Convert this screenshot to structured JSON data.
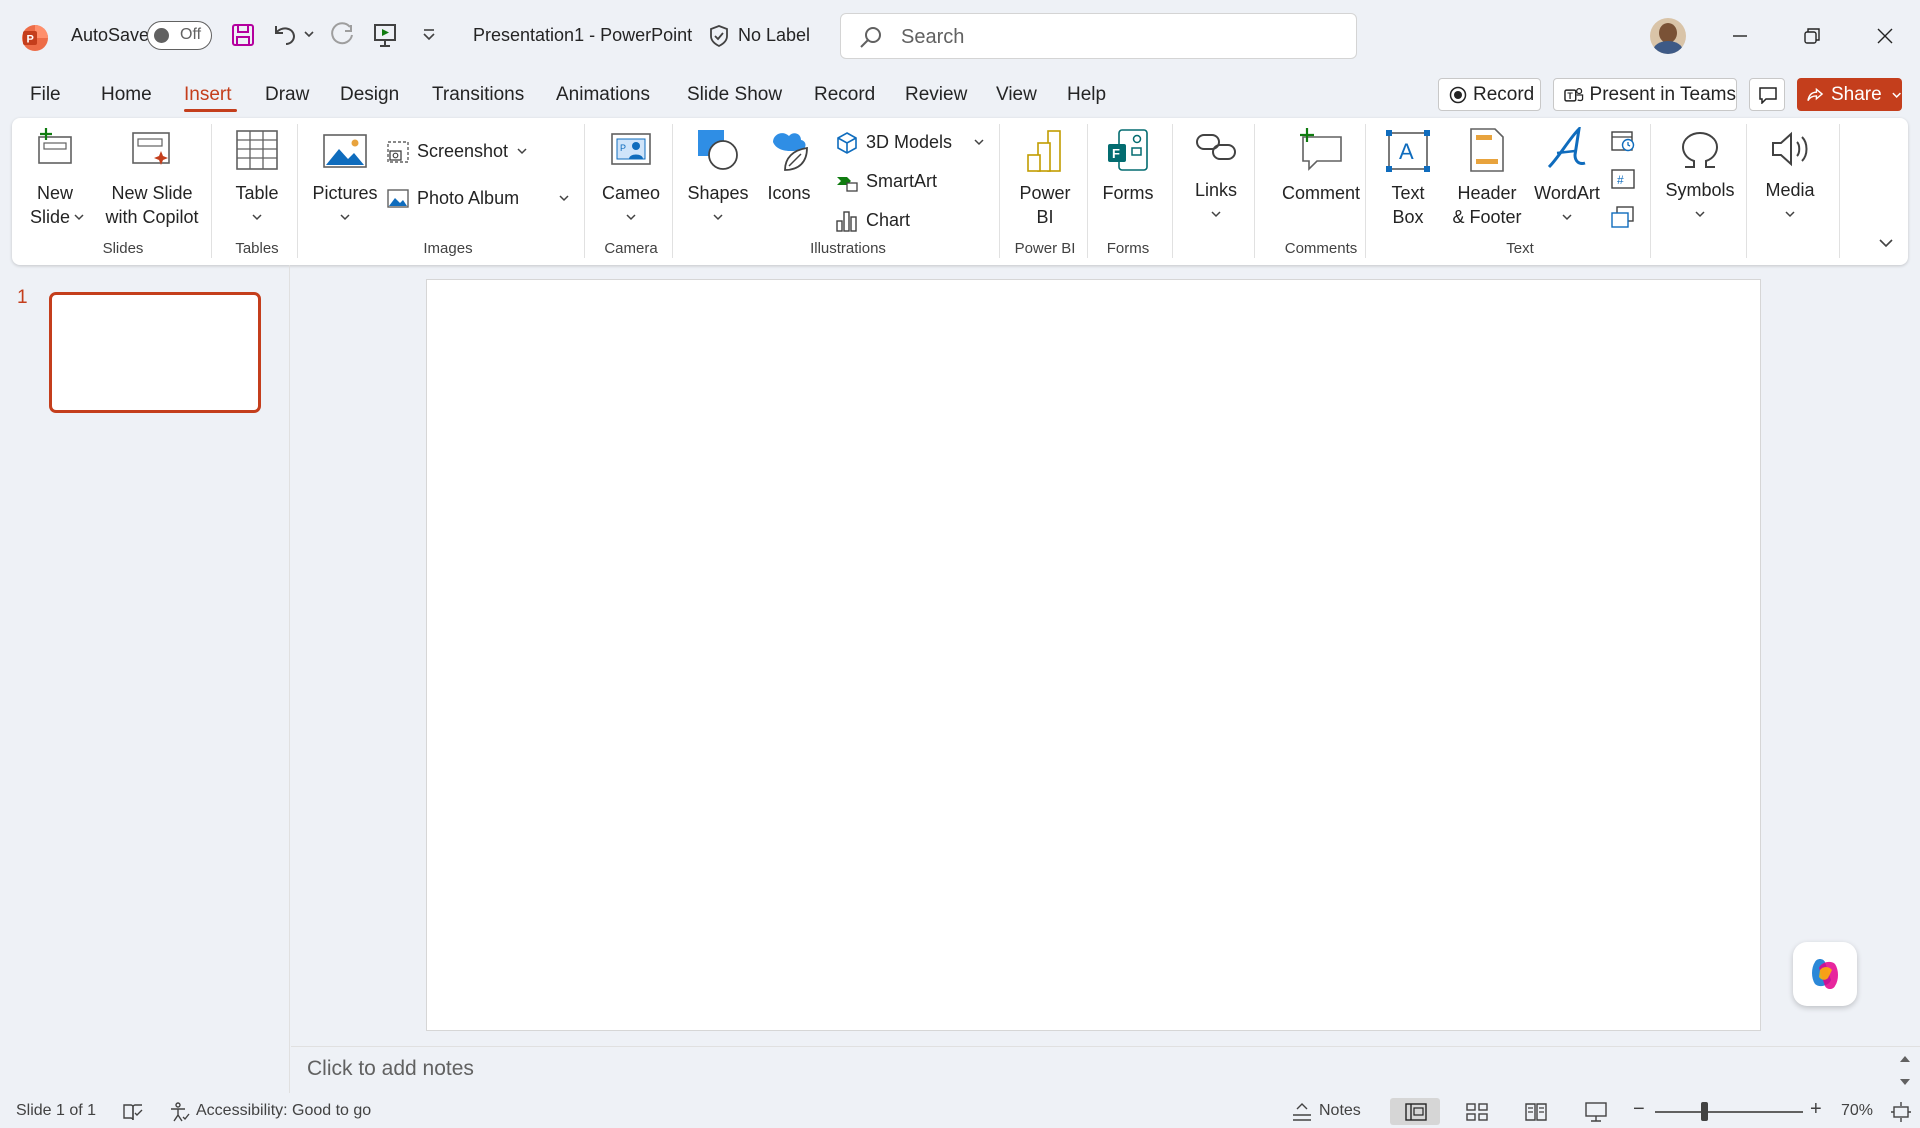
{
  "titlebar": {
    "autosave_label": "AutoSave",
    "autosave_state": "Off",
    "doc_title": "Presentation1  -  PowerPoint",
    "sensitivity_label": "No Label",
    "search_placeholder": "Search"
  },
  "tabs": [
    {
      "label": "File"
    },
    {
      "label": "Home"
    },
    {
      "label": "Insert"
    },
    {
      "label": "Draw"
    },
    {
      "label": "Design"
    },
    {
      "label": "Transitions"
    },
    {
      "label": "Animations"
    },
    {
      "label": "Slide Show"
    },
    {
      "label": "Record"
    },
    {
      "label": "Review"
    },
    {
      "label": "View"
    },
    {
      "label": "Help"
    }
  ],
  "active_tab": "Insert",
  "header_buttons": {
    "record": "Record",
    "present_in_teams": "Present in Teams",
    "share": "Share"
  },
  "ribbon": {
    "new_slide_1": "New",
    "new_slide_2": "Slide",
    "new_slide_copilot_1": "New Slide",
    "new_slide_copilot_2": "with Copilot",
    "table": "Table",
    "pictures": "Pictures",
    "screenshot": "Screenshot",
    "photo_album": "Photo Album",
    "cameo": "Cameo",
    "shapes": "Shapes",
    "icons": "Icons",
    "models_3d": "3D Models",
    "smartart": "SmartArt",
    "chart": "Chart",
    "power_bi_1": "Power",
    "power_bi_2": "BI",
    "forms": "Forms",
    "links": "Links",
    "comment": "Comment",
    "text_box_1": "Text",
    "text_box_2": "Box",
    "header_footer_1": "Header",
    "header_footer_2": "& Footer",
    "wordart": "WordArt",
    "symbols": "Symbols",
    "media": "Media",
    "groups": {
      "slides": "Slides",
      "tables": "Tables",
      "images": "Images",
      "camera": "Camera",
      "illustrations": "Illustrations",
      "power_bi": "Power BI",
      "forms": "Forms",
      "comments": "Comments",
      "text": "Text"
    }
  },
  "thumbnails": [
    {
      "number": "1"
    }
  ],
  "notes_placeholder": "Click to add notes",
  "statusbar": {
    "slide_info": "Slide 1 of 1",
    "accessibility": "Accessibility: Good to go",
    "notes": "Notes",
    "zoom": "70%"
  },
  "colors": {
    "accent": "#c43e1c",
    "background": "#eef1f6",
    "ribbon": "#ffffff"
  }
}
